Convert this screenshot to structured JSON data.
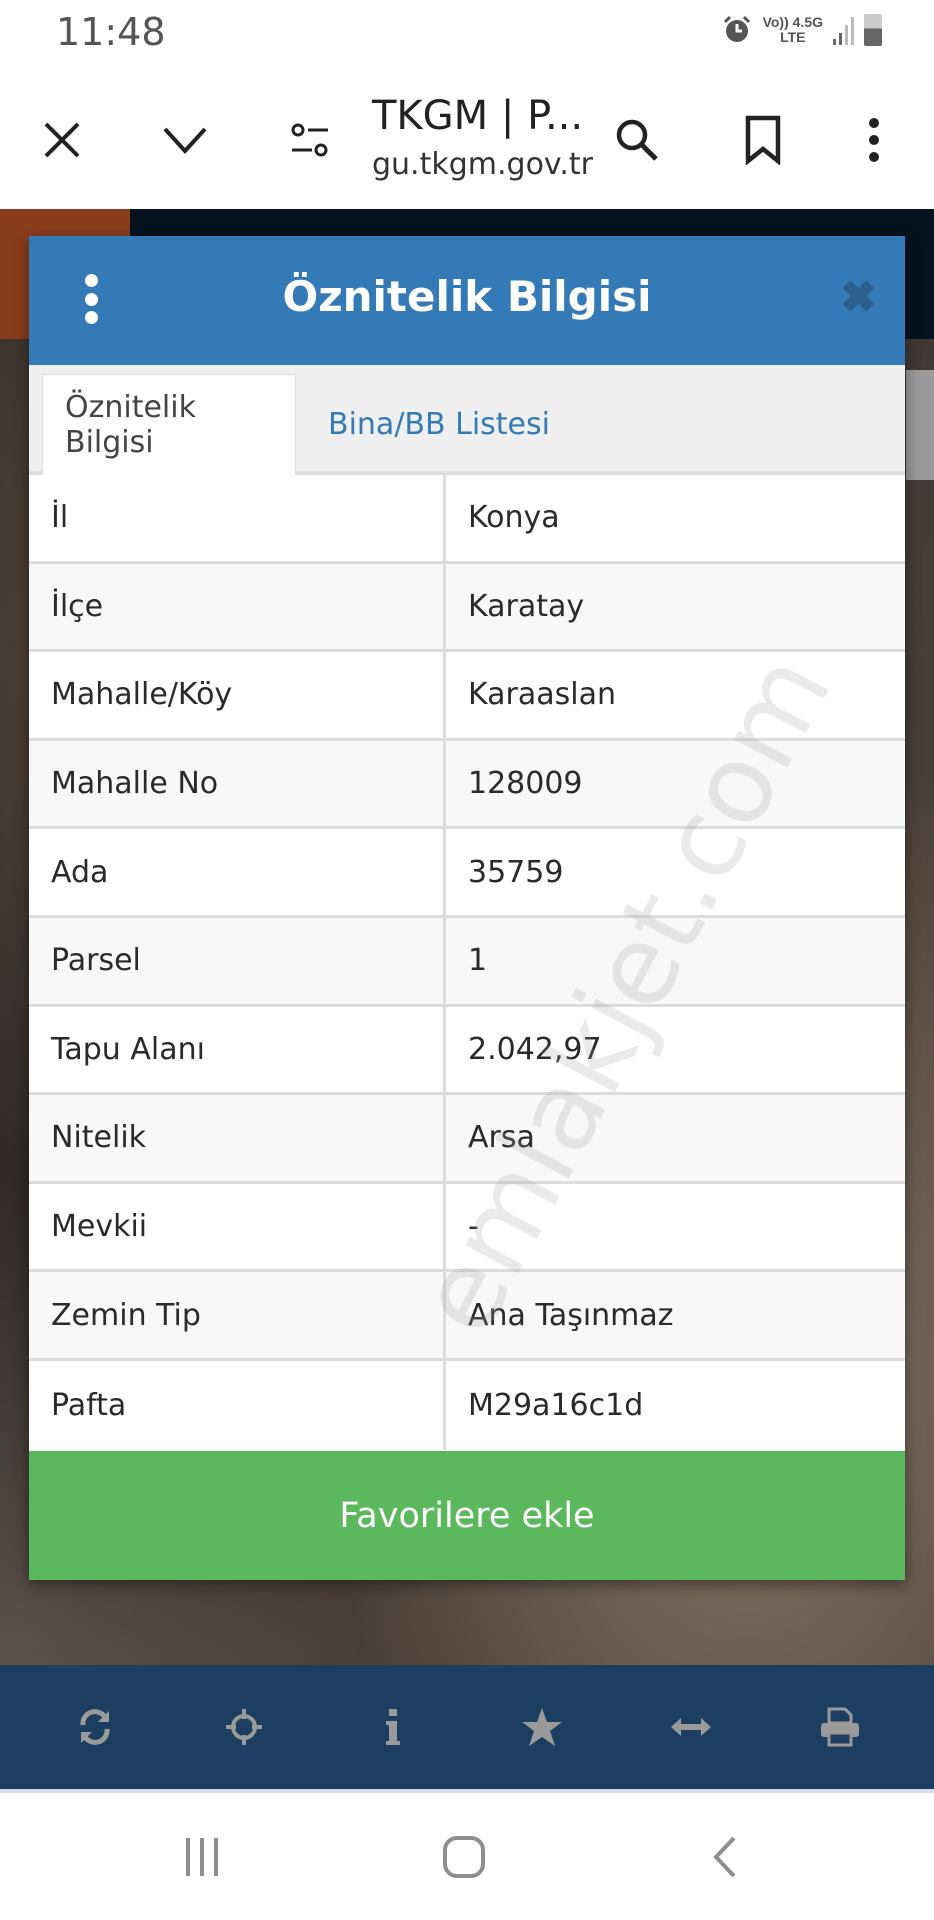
{
  "status_bar": {
    "time": "11:48",
    "network_top": "Vo)) 4.5G",
    "network_bottom": "LTE"
  },
  "browser": {
    "title": "TKGM | P...",
    "url": "gu.tkgm.gov.tr",
    "icons": [
      "close-icon",
      "chevron-down-icon",
      "site-settings-icon",
      "search-icon",
      "bookmark-icon",
      "more-vert-icon"
    ]
  },
  "modal": {
    "title": "Öznitelik Bilgisi",
    "close_glyph": "✖",
    "tabs": [
      {
        "label": "Öznitelik Bilgisi",
        "active": true
      },
      {
        "label": "Bina/BB Listesi",
        "active": false
      }
    ],
    "rows": [
      {
        "key": "İl",
        "value": "Konya"
      },
      {
        "key": "İlçe",
        "value": "Karatay"
      },
      {
        "key": "Mahalle/Köy",
        "value": "Karaaslan"
      },
      {
        "key": "Mahalle No",
        "value": "128009"
      },
      {
        "key": "Ada",
        "value": "35759"
      },
      {
        "key": "Parsel",
        "value": "1"
      },
      {
        "key": "Tapu Alanı",
        "value": "2.042,97"
      },
      {
        "key": "Nitelik",
        "value": "Arsa"
      },
      {
        "key": "Mevkii",
        "value": "-"
      },
      {
        "key": "Zemin Tip",
        "value": "Ana Taşınmaz"
      },
      {
        "key": "Pafta",
        "value": "M29a16c1d"
      }
    ],
    "favorite_button": "Favorilere ekle"
  },
  "watermark": "emlakjet.com",
  "toolbar": {
    "icons": [
      "refresh-icon",
      "locate-icon",
      "info-icon",
      "star-icon",
      "measure-icon",
      "print-icon"
    ]
  },
  "colors": {
    "header_blue": "#337ab7",
    "button_green": "#5cb85c",
    "toolbar_navy": "#1c3e60"
  }
}
